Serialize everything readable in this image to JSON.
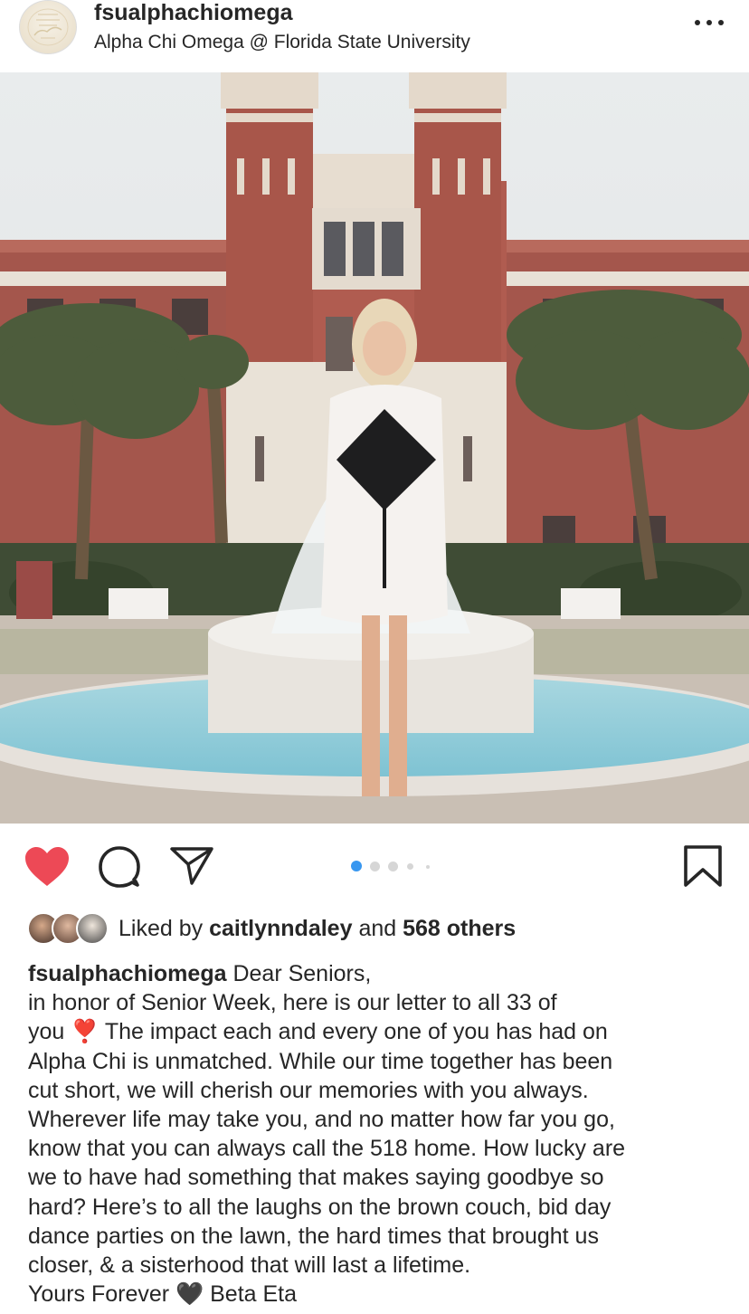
{
  "post": {
    "username": "fsualphachiomega",
    "location": "Alpha Chi Omega @ Florida State University",
    "avatar_text": "Alpha Chi Omega Florida State"
  },
  "icons": {
    "like": "heart-filled-icon",
    "comment": "comment-bubble-icon",
    "share": "paper-plane-icon",
    "save": "bookmark-icon",
    "more": "more-options-icon"
  },
  "colors": {
    "like_red": "#ed4956",
    "carousel_active": "#3897f0",
    "text": "#262626"
  },
  "carousel": {
    "count": 5,
    "active_index": 0
  },
  "likes": {
    "prefix": "Liked by",
    "liker": "caitlynndaley",
    "middle": "and",
    "others": "568 others"
  },
  "caption": {
    "author": "fsualphachiomega",
    "lines": [
      "Dear Seniors,",
      "in honor of Senior Week, here is our letter to all 33 of",
      "you ❣️ The impact each and every one of you has had on",
      "Alpha Chi is unmatched. While our time together has been",
      "cut short, we will cherish our memories with you always.",
      "Wherever life may take you, and no matter how far you go,",
      "know that you can always call the 518 home. How lucky are",
      "we to have had something that makes saying goodbye so",
      "hard? Here’s to all the laughs on the brown couch, bid day",
      "dance parties on the lawn, the hard times that brought us",
      "closer, & a sisterhood that will last a lifetime.",
      "Yours Forever 🖤 Beta Eta"
    ]
  }
}
